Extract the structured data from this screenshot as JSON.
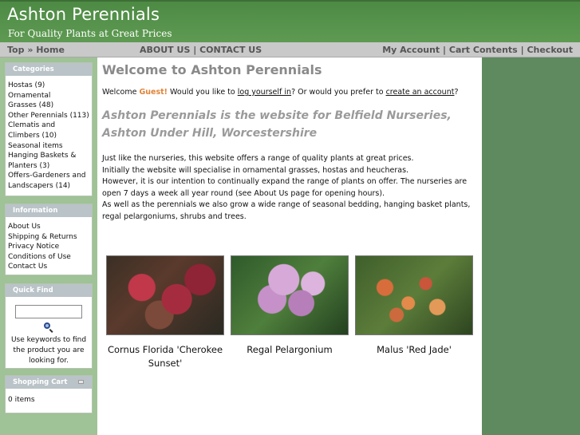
{
  "header": {
    "title": "Ashton Perennials",
    "tagline": "For Quality Plants at Great Prices"
  },
  "navbar": {
    "top": "Top",
    "separator": "»",
    "home": "Home",
    "about": "ABOUT US",
    "divider": "|",
    "contact": "CONTACT US",
    "my_account": "My Account",
    "cart_contents": "Cart Contents",
    "checkout": "Checkout"
  },
  "sidebar": {
    "categories": {
      "title": "Categories",
      "items": [
        "Hostas (9)",
        "Ornamental",
        "Grasses (48)",
        "Other Perennials (113)",
        "Clematis and",
        "Climbers (10)",
        "Seasonal items",
        "Hanging Baskets &",
        "Planters (3)",
        "Offers-Gardeners and",
        "Landscapers (14)"
      ]
    },
    "information": {
      "title": "Information",
      "items": [
        "About Us",
        "Shipping & Returns",
        "Privacy Notice",
        "Conditions of Use",
        "Contact Us"
      ]
    },
    "quick_find": {
      "title": "Quick Find",
      "input_value": "",
      "help": "Use keywords to find the product you are looking for."
    },
    "shopping_cart": {
      "title": "Shopping Cart",
      "status": "0 items"
    }
  },
  "main": {
    "heading": "Welcome to Ashton Perennials",
    "welcome": {
      "prefix": "Welcome ",
      "guest": "Guest!",
      "mid": " Would you like to ",
      "login_link": "log yourself in",
      "mid2": "? Or would you prefer to ",
      "create_link": "create an account",
      "suffix": "?"
    },
    "intro_heading": "Ashton Perennials is the website for Belfield Nurseries, Ashton Under Hill, Worcestershire",
    "paragraphs": [
      "Just like the nurseries, this website offers a range of quality plants at great prices.",
      "Initially the website will specialise in ornamental grasses, hostas and heucheras.",
      "However, it is our intention to continually expand the range of plants on offer. The nurseries are open 7 days a week all year round (see About Us page for opening hours).",
      "As well as the perennials we also grow a wide range of seasonal bedding, hanging basket plants, regal pelargoniums, shrubs and trees."
    ],
    "products": [
      {
        "name": "Cornus Florida 'Cherokee Sunset'"
      },
      {
        "name": "Regal Pelargonium"
      },
      {
        "name": "Malus 'Red Jade'"
      }
    ]
  },
  "colors": {
    "header_green": "#4d8a44",
    "sidebar_green": "#9fc296",
    "right_green": "#5f8a5f",
    "guest_orange": "#e0843a",
    "box_header": "#b9c3c8"
  }
}
